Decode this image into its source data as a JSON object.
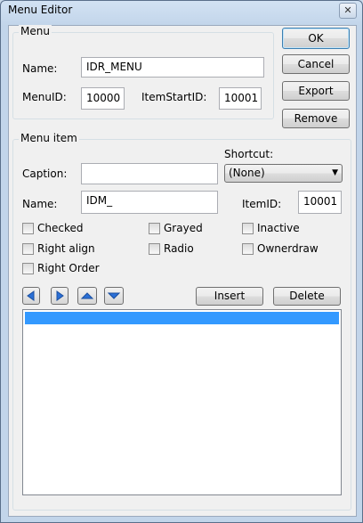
{
  "window": {
    "title": "Menu Editor",
    "close_glyph": "✕"
  },
  "menu_group": {
    "label": "Menu",
    "name_label": "Name:",
    "name_value": "IDR_MENU",
    "menuid_label": "MenuID:",
    "menuid_value": "10000",
    "itemstartid_label": "ItemStartID:",
    "itemstartid_value": "10001"
  },
  "buttons": {
    "ok": "OK",
    "cancel": "Cancel",
    "export": "Export",
    "remove": "Remove",
    "insert": "Insert",
    "delete": "Delete"
  },
  "menuitem_group": {
    "label": "Menu item",
    "caption_label": "Caption:",
    "caption_value": "",
    "shortcut_label": "Shortcut:",
    "shortcut_value": "(None)",
    "name_label": "Name:",
    "name_value": "IDM_",
    "itemid_label": "ItemID:",
    "itemid_value": "10001"
  },
  "checkboxes": {
    "checked": "Checked",
    "grayed": "Grayed",
    "inactive": "Inactive",
    "right_align": "Right align",
    "radio": "Radio",
    "ownerdraw": "Ownerdraw",
    "right_order": "Right Order"
  },
  "icons": {
    "move_left": "arrow-left-icon",
    "move_right": "arrow-right-icon",
    "move_up": "arrow-up-icon",
    "move_down": "arrow-down-icon",
    "dropdown": "chevron-down-icon"
  },
  "colors": {
    "selection": "#3399ff",
    "arrow_fill": "#2a6fd6"
  }
}
